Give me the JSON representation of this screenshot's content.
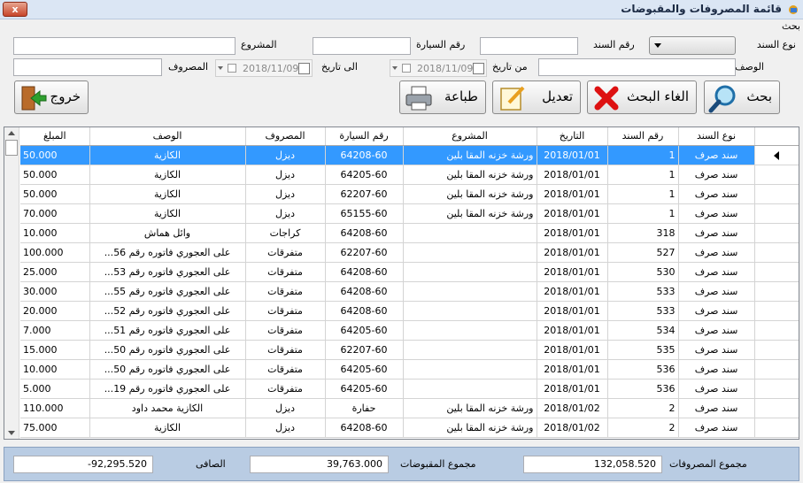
{
  "window": {
    "title": "قائمة المصروفات والمقبوضات",
    "close_label": "x"
  },
  "search": {
    "group_label": "بحث",
    "type_label": "نوع السند",
    "voucher_no_label": "رقم السند",
    "car_no_label": "رقم السيارة",
    "project_label": "المشروع",
    "description_label": "الوصف",
    "from_date_label": "من تاريخ",
    "to_date_label": "الى تاريخ",
    "expense_label": "المصروف",
    "from_date_value": "2018/11/09",
    "to_date_value": "2018/11/09"
  },
  "toolbar": {
    "search_label": "بحث",
    "cancel_search_label": "الغاء البحث",
    "edit_label": "تعديل",
    "print_label": "طباعة",
    "exit_label": "خروج"
  },
  "table": {
    "columns": [
      "نوع السند",
      "رقم السند",
      "التاريخ",
      "المشروع",
      "رقم السيارة",
      "المصروف",
      "الوصف",
      "المبلغ"
    ],
    "rows": [
      [
        "سند صرف",
        "1",
        "2018/01/01",
        "ورشة خزنه المقا بلين",
        "64208-60",
        "ديزل",
        "الكازية",
        "50.000"
      ],
      [
        "سند صرف",
        "1",
        "2018/01/01",
        "ورشة خزنه المقا بلين",
        "64205-60",
        "ديزل",
        "الكازية",
        "50.000"
      ],
      [
        "سند صرف",
        "1",
        "2018/01/01",
        "ورشة خزنه المقا بلين",
        "62207-60",
        "ديزل",
        "الكازية",
        "50.000"
      ],
      [
        "سند صرف",
        "1",
        "2018/01/01",
        "ورشة خزنه المقا بلين",
        "65155-60",
        "ديزل",
        "الكازية",
        "70.000"
      ],
      [
        "سند صرف",
        "318",
        "2018/01/01",
        "",
        "64208-60",
        "كراجات",
        "وائل هماش",
        "10.000"
      ],
      [
        "سند صرف",
        "527",
        "2018/01/01",
        "",
        "62207-60",
        "متفرقات",
        "...على العجوري فاتوره رقم 56",
        "100.000"
      ],
      [
        "سند صرف",
        "530",
        "2018/01/01",
        "",
        "64208-60",
        "متفرقات",
        "...على العجوري فاتوره رقم 53",
        "25.000"
      ],
      [
        "سند صرف",
        "533",
        "2018/01/01",
        "",
        "64208-60",
        "متفرقات",
        "...على العجوري فاتوره رقم 55",
        "30.000"
      ],
      [
        "سند صرف",
        "533",
        "2018/01/01",
        "",
        "64208-60",
        "متفرقات",
        "...على العجوري فاتوره رقم 52",
        "20.000"
      ],
      [
        "سند صرف",
        "534",
        "2018/01/01",
        "",
        "64205-60",
        "متفرقات",
        "...على العجوري فاتوره رقم 51",
        "7.000"
      ],
      [
        "سند صرف",
        "535",
        "2018/01/01",
        "",
        "62207-60",
        "متفرقات",
        "...على العجوري فاتوره رقم 50",
        "15.000"
      ],
      [
        "سند صرف",
        "536",
        "2018/01/01",
        "",
        "64205-60",
        "متفرقات",
        "...على العجوري فاتوره رقم 50",
        "10.000"
      ],
      [
        "سند صرف",
        "536",
        "2018/01/01",
        "",
        "64205-60",
        "متفرقات",
        "...على العجوري فاتوره رقم 19",
        "5.000"
      ],
      [
        "سند صرف",
        "2",
        "2018/01/02",
        "ورشة خزنه المقا بلين",
        "حفارة",
        "ديزل",
        "الكازية محمد داود",
        "110.000"
      ],
      [
        "سند صرف",
        "2",
        "2018/01/02",
        "ورشة خزنه المقا بلين",
        "64208-60",
        "ديزل",
        "الكازية",
        "75.000"
      ]
    ]
  },
  "footer": {
    "total_expenses_label": "مجموع المصروفات",
    "total_expenses_value": "132,058.520",
    "total_receipts_label": "مجموع المقبوضات",
    "total_receipts_value": "39,763.000",
    "net_label": "الصافى",
    "net_value": "-92,295.520"
  }
}
